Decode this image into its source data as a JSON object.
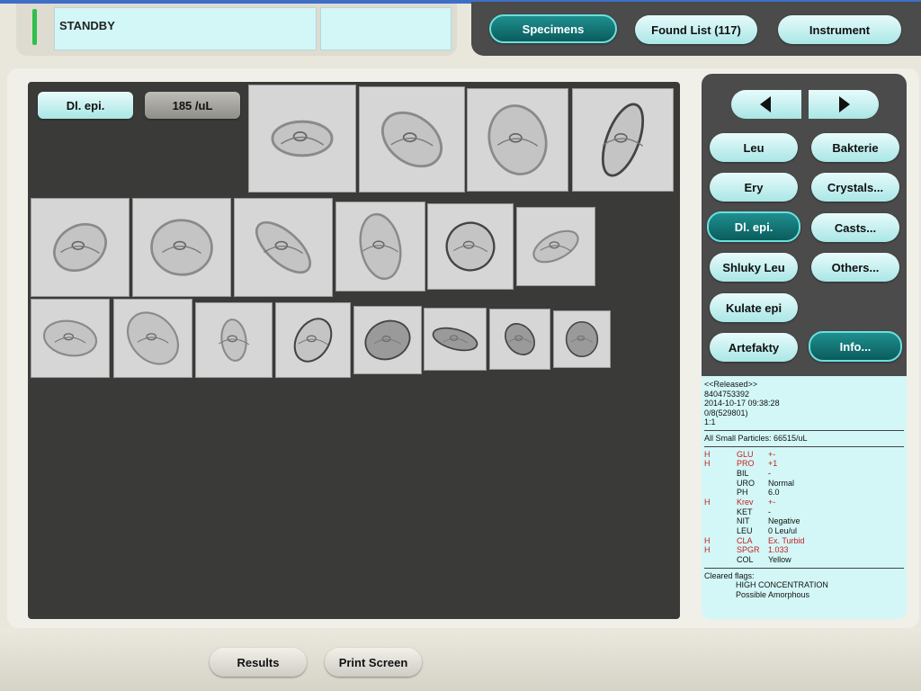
{
  "status": {
    "text": "STANDBY"
  },
  "nav": {
    "specimens": "Specimens",
    "found_list": "Found List (117)",
    "instrument": "Instrument"
  },
  "image_panel": {
    "category": "Dl. epi.",
    "concentration": "185 /uL"
  },
  "categories": {
    "leu": "Leu",
    "bakterie": "Bakterie",
    "ery": "Ery",
    "crystals": "Crystals...",
    "dl_epi": "Dl. epi.",
    "casts": "Casts...",
    "shluky_leu": "Shluky Leu",
    "others": "Others...",
    "kulate_epi": "Kulate epi",
    "artefakty": "Artefakty",
    "info": "Info..."
  },
  "info": {
    "released": "<<Released>>",
    "sample_id": "8404753392",
    "datetime": "2014-10-17 09:38:28",
    "rack": "0/8(529801)",
    "dilution": "1:1",
    "small_particles": "All Small Particles: 66515/uL",
    "urinalysis": [
      {
        "flag": "H",
        "name": "GLU",
        "value": "+-",
        "abnormal": true
      },
      {
        "flag": "H",
        "name": "PRO",
        "value": "+1",
        "abnormal": true
      },
      {
        "flag": "",
        "name": "BIL",
        "value": "-",
        "abnormal": false
      },
      {
        "flag": "",
        "name": "URO",
        "value": "Normal",
        "abnormal": false
      },
      {
        "flag": "",
        "name": "PH",
        "value": "6.0",
        "abnormal": false
      },
      {
        "flag": "H",
        "name": "Krev",
        "value": "+-",
        "abnormal": true
      },
      {
        "flag": "",
        "name": "KET",
        "value": "-",
        "abnormal": false
      },
      {
        "flag": "",
        "name": "NIT",
        "value": "Negative",
        "abnormal": false
      },
      {
        "flag": "",
        "name": "LEU",
        "value": "0 Leu/ul",
        "abnormal": false
      },
      {
        "flag": "H",
        "name": "CLA",
        "value": "Ex. Turbid",
        "abnormal": true
      },
      {
        "flag": "H",
        "name": "SPGR",
        "value": "1.033",
        "abnormal": true
      },
      {
        "flag": "",
        "name": "COL",
        "value": "Yellow",
        "abnormal": false
      }
    ],
    "cleared_flags_label": "Cleared flags:",
    "cleared_flags": [
      "HIGH CONCENTRATION",
      "Possible Amorphous"
    ]
  },
  "bottom": {
    "results": "Results",
    "print_screen": "Print Screen"
  },
  "colors": {
    "accent": "#0b5c5c",
    "pill": "#a9e6e6",
    "info_bg": "#d3f7f7",
    "abnormal": "#c81e1e",
    "status_led": "#2fbf4a"
  },
  "icons": {
    "prev": "arrow-left-icon",
    "next": "arrow-right-icon"
  }
}
